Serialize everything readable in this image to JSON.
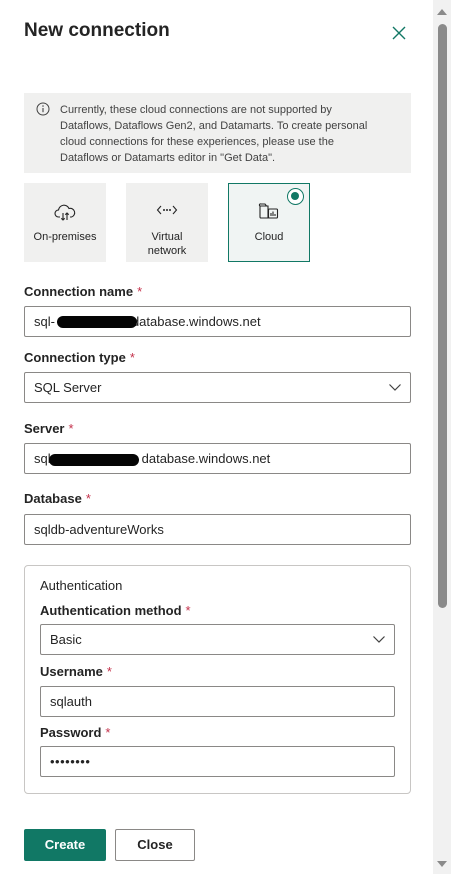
{
  "header": {
    "title": "New connection",
    "close_icon": "close-icon"
  },
  "info_banner": {
    "icon": "info-icon",
    "lines": [
      "Currently, these cloud connections are not supported by",
      "Dataflows, Dataflows Gen2, and Datamarts. To create personal",
      "cloud connections for these experiences, please use the",
      "Dataflows or Datamarts editor in \"Get Data\"."
    ]
  },
  "connection_kinds": [
    {
      "label": "On-premises",
      "icon": "cloud-gateway-icon",
      "selected": false
    },
    {
      "label_line1": "Virtual",
      "label_line2": "network",
      "icon": "virtual-network-icon",
      "selected": false
    },
    {
      "label": "Cloud",
      "icon": "cloud-app-icon",
      "selected": true
    }
  ],
  "form": {
    "connection_name": {
      "label": "Connection name",
      "required": "*",
      "prefix": "sql-",
      "suffix": "database.windows.net"
    },
    "connection_type": {
      "label": "Connection type",
      "required": "*",
      "value": "SQL Server"
    },
    "server": {
      "label": "Server",
      "required": "*",
      "prefix": "sql",
      "suffix": "database.windows.net"
    },
    "database": {
      "label": "Database",
      "required": "*",
      "value": "sqldb-adventureWorks"
    }
  },
  "authentication": {
    "section_title": "Authentication",
    "method": {
      "label": "Authentication method",
      "required": "*",
      "value": "Basic"
    },
    "username": {
      "label": "Username",
      "required": "*",
      "value": "sqlauth"
    },
    "password": {
      "label": "Password",
      "required": "*",
      "value": "••••••••"
    }
  },
  "buttons": {
    "create": "Create",
    "close": "Close"
  },
  "colors": {
    "accent": "#117865",
    "required": "#c4314b",
    "banner_bg": "#f0f0ef"
  }
}
